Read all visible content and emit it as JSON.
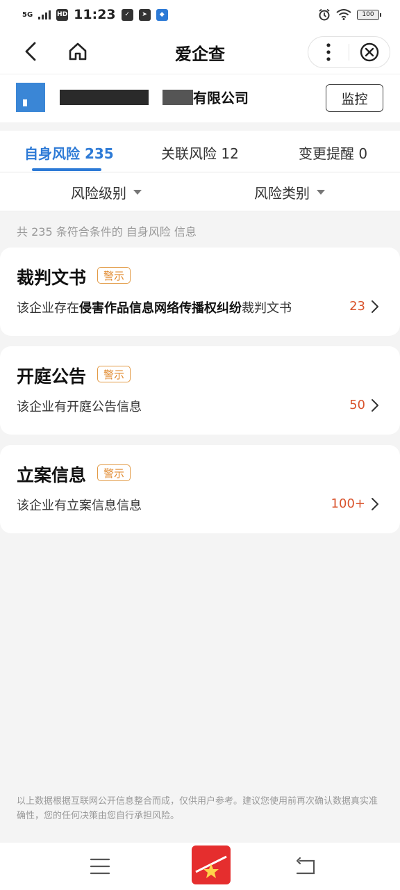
{
  "status_bar": {
    "network": "5G",
    "hd": "HD",
    "time": "11:23",
    "battery": "100",
    "icons": [
      "signal-icon",
      "shield-check-icon",
      "telegram-icon",
      "app-icon",
      "alarm-icon",
      "wifi-icon",
      "battery-icon"
    ]
  },
  "nav": {
    "title": "爱企查",
    "icons": [
      "back-icon",
      "home-icon",
      "more-icon",
      "close-icon"
    ]
  },
  "company": {
    "name_visible": "有限公司",
    "monitor_label": "监控"
  },
  "tabs": [
    {
      "label": "自身风险 235",
      "active": true
    },
    {
      "label": "关联风险 12",
      "active": false
    },
    {
      "label": "变更提醒 0",
      "active": false
    }
  ],
  "filters": {
    "level": "风险级别",
    "type": "风险类别"
  },
  "summary": "共 235 条符合条件的 自身风险 信息",
  "cards": [
    {
      "title": "裁判文书",
      "badge": "警示",
      "desc_prefix": "该企业存在",
      "desc_bold": "侵害作品信息网络传播权纠纷",
      "desc_suffix": "裁判文书",
      "count": "23"
    },
    {
      "title": "开庭公告",
      "badge": "警示",
      "desc_prefix": "该企业有开庭公告信息",
      "desc_bold": "",
      "desc_suffix": "",
      "count": "50"
    },
    {
      "title": "立案信息",
      "badge": "警示",
      "desc_prefix": "该企业有立案信息信息",
      "desc_bold": "",
      "desc_suffix": "",
      "count": "100+"
    }
  ],
  "disclaimer": "以上数据根据互联网公开信息整合而成，仅供用户参考。建议您使用前再次确认数据真实准确性，您的任何决策由您自行承担风险。",
  "colors": {
    "accent": "#2d7ad6",
    "warning": "#e0882c",
    "count": "#d9532c",
    "app_logo": "#e52e2e"
  }
}
